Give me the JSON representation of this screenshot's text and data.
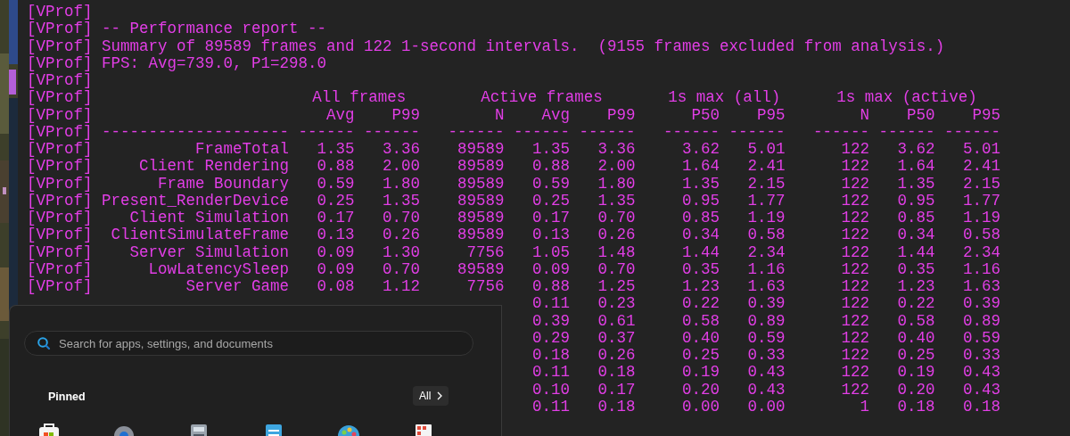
{
  "console": {
    "lines": [
      {
        "prefix": "[VProf]"
      },
      {
        "prefix": "[VProf]",
        "text": "-- Performance report --"
      },
      {
        "prefix": "[VProf]",
        "text": "Summary of 89589 frames and 122 1-second intervals.  (9155 frames excluded from analysis.)"
      },
      {
        "prefix": "[VProf]",
        "text": "FPS: Avg=739.0, P1=298.0"
      },
      {
        "prefix": "[VProf]"
      }
    ],
    "table": {
      "group_header": {
        "prefix": "[VProf]",
        "groups": [
          "All frames",
          "Active frames",
          "1s max (all)",
          "1s max (active)"
        ]
      },
      "column_header": {
        "prefix": "[VProf]",
        "cells": [
          "Avg",
          "P99",
          "N",
          "Avg",
          "P99",
          "P50",
          "P95",
          "N",
          "P50",
          "P95"
        ]
      },
      "rule": {
        "prefix": "[VProf]",
        "cells": [
          "--------------------",
          "------",
          "------",
          "------",
          "------",
          "------",
          "------",
          "------",
          "------",
          "------",
          "------"
        ]
      },
      "rows": [
        {
          "prefix": "[VProf]",
          "label": "FrameTotal",
          "values": [
            "1.35",
            "3.36",
            "89589",
            "1.35",
            "3.36",
            "3.62",
            "5.01",
            "122",
            "3.62",
            "5.01"
          ]
        },
        {
          "prefix": "[VProf]",
          "label": "Client Rendering",
          "values": [
            "0.88",
            "2.00",
            "89589",
            "0.88",
            "2.00",
            "1.64",
            "2.41",
            "122",
            "1.64",
            "2.41"
          ]
        },
        {
          "prefix": "[VProf]",
          "label": "Frame Boundary",
          "values": [
            "0.59",
            "1.80",
            "89589",
            "0.59",
            "1.80",
            "1.35",
            "2.15",
            "122",
            "1.35",
            "2.15"
          ]
        },
        {
          "prefix": "[VProf]",
          "label": "Present_RenderDevice",
          "values": [
            "0.25",
            "1.35",
            "89589",
            "0.25",
            "1.35",
            "0.95",
            "1.77",
            "122",
            "0.95",
            "1.77"
          ]
        },
        {
          "prefix": "[VProf]",
          "label": "Client Simulation",
          "values": [
            "0.17",
            "0.70",
            "89589",
            "0.17",
            "0.70",
            "0.85",
            "1.19",
            "122",
            "0.85",
            "1.19"
          ]
        },
        {
          "prefix": "[VProf]",
          "label": "ClientSimulateFrame",
          "values": [
            "0.13",
            "0.26",
            "89589",
            "0.13",
            "0.26",
            "0.34",
            "0.58",
            "122",
            "0.34",
            "0.58"
          ]
        },
        {
          "prefix": "[VProf]",
          "label": "Server Simulation",
          "values": [
            "0.09",
            "1.30",
            "7756",
            "1.05",
            "1.48",
            "1.44",
            "2.34",
            "122",
            "1.44",
            "2.34"
          ]
        },
        {
          "prefix": "[VProf]",
          "label": "LowLatencySleep",
          "values": [
            "0.09",
            "0.70",
            "89589",
            "0.09",
            "0.70",
            "0.35",
            "1.16",
            "122",
            "0.35",
            "1.16"
          ]
        },
        {
          "prefix": "[VProf]",
          "label": "Server Game",
          "values": [
            "0.08",
            "1.12",
            "7756",
            "0.88",
            "1.25",
            "1.23",
            "1.63",
            "122",
            "1.23",
            "1.63"
          ]
        },
        {
          "values": [
            "0.11",
            "0.23",
            "0.22",
            "0.39",
            "122",
            "0.22",
            "0.39"
          ]
        },
        {
          "values": [
            "0.39",
            "0.61",
            "0.58",
            "0.89",
            "122",
            "0.58",
            "0.89"
          ]
        },
        {
          "values": [
            "0.29",
            "0.37",
            "0.40",
            "0.59",
            "122",
            "0.40",
            "0.59"
          ]
        },
        {
          "values": [
            "0.18",
            "0.26",
            "0.25",
            "0.33",
            "122",
            "0.25",
            "0.33"
          ]
        },
        {
          "values": [
            "0.11",
            "0.18",
            "0.19",
            "0.43",
            "122",
            "0.19",
            "0.43"
          ]
        },
        {
          "values": [
            "0.10",
            "0.17",
            "0.20",
            "0.43",
            "122",
            "0.20",
            "0.43"
          ]
        },
        {
          "values": [
            "0.11",
            "0.18",
            "0.00",
            "0.00",
            "1",
            "0.18",
            "0.18"
          ]
        }
      ]
    }
  },
  "start_menu": {
    "search": {
      "placeholder": "Search for apps, settings, and documents"
    },
    "pinned_title": "Pinned",
    "all_button": "All",
    "apps": [
      {
        "kind": "store"
      },
      {
        "kind": "settings"
      },
      {
        "kind": "calculator"
      },
      {
        "kind": "notepad"
      },
      {
        "kind": "paint"
      },
      {
        "kind": "document"
      }
    ]
  }
}
